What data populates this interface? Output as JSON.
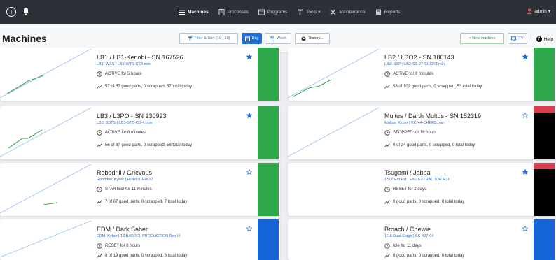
{
  "colors": {
    "nav_bg": "#2c3138",
    "active_blue": "#1f6fd6",
    "status_green": "#2ea84b",
    "status_black": "#000000",
    "status_blue": "#1565d8",
    "status_red": "#d8404f",
    "star_filled": "#1f6fd6"
  },
  "nav": {
    "logo_letter": "T",
    "items": [
      {
        "label": "Machines",
        "icon": "list-icon",
        "active": true
      },
      {
        "label": "Processes",
        "icon": "document-icon",
        "active": false
      },
      {
        "label": "Programs",
        "icon": "code-icon",
        "active": false
      },
      {
        "label": "Tools ▾",
        "icon": "tool-icon",
        "active": false
      },
      {
        "label": "Maintenance",
        "icon": "wrench-icon",
        "active": false
      },
      {
        "label": "Reports",
        "icon": "report-icon",
        "active": false
      }
    ],
    "user": "admin ▾"
  },
  "toolbar": {
    "title": "Machines",
    "filter_label": "Filter & Sort (10 | 10)",
    "day_label": "Day",
    "week_label": "Week",
    "history_label": "History...",
    "new_machine_label": "+ New machine",
    "tv_label": "TV",
    "help_label": "Help"
  },
  "machines": [
    {
      "title": "LB1 / LB1-Kenobi - SN 167526",
      "subtitle": "LB1: WSS | LB1-WTS-CS4.min",
      "status": "ACTIVE for 5 hours",
      "parts": "57 of 57 good parts, 0 scrapped, 57 total today",
      "starred": true,
      "state_color": "green",
      "red_cap": false
    },
    {
      "title": "LB2 / LBO2 - SN 180143",
      "subtitle": "LB2: SSP | LB2-SS-27-SHORT.min",
      "status": "ACTIVE for 9 minutes",
      "parts": "53 of 102 good parts, 0 scrapped, 53 total today",
      "starred": true,
      "state_color": "green",
      "red_cap": false
    },
    {
      "title": "LB3 / L3PO - SN 230923",
      "subtitle": "LB3: SSTS | LB3-STS-CS-4.min",
      "status": "ACTIVE for 8 minutes",
      "parts": "56 of 87 good parts, 0 scrapped, 56 total today",
      "starred": true,
      "state_color": "green",
      "red_cap": false
    },
    {
      "title": "Multus / Darth Multus - SN 152319",
      "subtitle": "Multus: Kyber | KC-44-CHERB.min",
      "status": "STOPPED for 16 hours",
      "parts": "0 of 24 good parts, 0 scrapped, 0 total today",
      "starred": false,
      "state_color": "black",
      "red_cap": true
    },
    {
      "title": "Robodrill / Grievous",
      "subtitle": "Robodrill: Kyber | ROBOT PROD",
      "status": "STARTED for 11 minutes",
      "parts": "7 of 67 good parts, 0 scrapped, 7 total today",
      "starred": false,
      "state_color": "green",
      "red_cap": false
    },
    {
      "title": "Tsugami / Jabba",
      "subtitle": "TSU: Ext Ext | EXT EXTRACTOR R3I",
      "status": "RESET for 2 days",
      "parts": "0 good parts, 0 scrapped, 0 total today",
      "starred": true,
      "state_color": "black",
      "red_cap": true
    },
    {
      "title": "EDM / Dark Saber",
      "subtitle": "EDM: Kyber | 12 BARREL PRODUCTION Rev H",
      "status": "RESET for 8 hours",
      "parts": "8 of 19 good parts, 0 scrapped, 8 total today",
      "starred": false,
      "state_color": "blue",
      "red_cap": false
    },
    {
      "title": "Broach / Chewie",
      "subtitle": "1/16 Dual Stage | SS-427-04",
      "status": "Idle for 11 days",
      "parts": "0 good parts, 0 scrapped, 0 total today",
      "starred": false,
      "state_color": "blue",
      "red_cap": false
    }
  ]
}
